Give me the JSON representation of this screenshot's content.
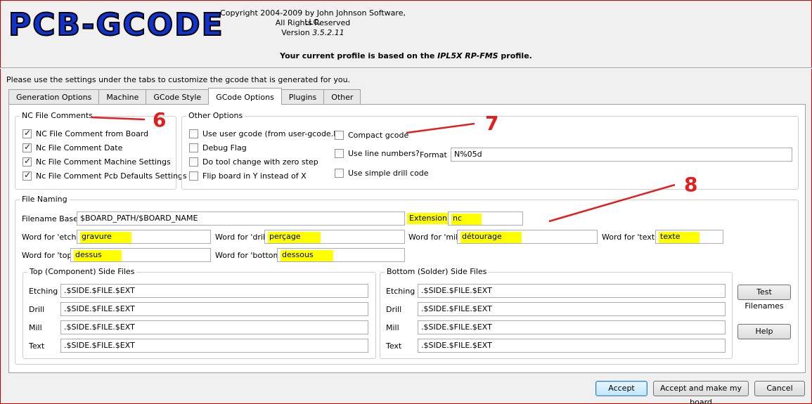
{
  "header": {
    "logo": "PCB-GCODE",
    "copyright": "Copyright 2004-2009 by John Johnson Software, LLC.",
    "rights": "All Rights Reserved",
    "version_label": "Version",
    "version": "3.5.2.11",
    "profile_pre": "Your current profile is based on the",
    "profile_name": "IPL5X RP-FMS",
    "profile_post": "profile."
  },
  "intro": "Please use the settings under the tabs to customize the gcode that is generated for you.",
  "tabs": [
    "Generation Options",
    "Machine",
    "GCode Style",
    "GCode Options",
    "Plugins",
    "Other"
  ],
  "active_tab": "GCode Options",
  "nc_comments": {
    "title": "NC File Comments",
    "items": [
      {
        "label": "NC File Comment from Board",
        "checked": true
      },
      {
        "label": "Nc File Comment Date",
        "checked": true
      },
      {
        "label": "Nc File Comment Machine Settings",
        "checked": true
      },
      {
        "label": "Nc File Comment Pcb Defaults Settings",
        "checked": true
      }
    ]
  },
  "other_options": {
    "title": "Other Options",
    "left": [
      {
        "label": "Use user gcode (from user-gcode.h)",
        "checked": false
      },
      {
        "label": "Debug Flag",
        "checked": false
      },
      {
        "label": "Do tool change with zero step",
        "checked": false
      },
      {
        "label": "Flip board in Y instead of X",
        "checked": false
      }
    ],
    "right": [
      {
        "label": "Compact gcode",
        "checked": false
      },
      {
        "label": "Use line numbers?",
        "checked": false
      },
      {
        "label": "Use simple drill code",
        "checked": false
      }
    ],
    "format_label": "Format",
    "format_value": "N%05d"
  },
  "file_naming": {
    "title": "File Naming",
    "filename_base_label": "Filename Base",
    "filename_base": "$BOARD_PATH/$BOARD_NAME",
    "extension_label": "Extension",
    "extension": "nc",
    "etch_label": "Word for 'etch'",
    "etch": "gravure",
    "drill_label": "Word for 'drill'",
    "drill": "perçage",
    "mill_label": "Word for 'mill'",
    "mill": "détourage",
    "text_label": "Word for 'text'",
    "text": "texte",
    "top_label": "Word for 'top'",
    "top": "dessus",
    "bottom_label": "Word for 'bottom'",
    "bottom": "dessous",
    "top_side": {
      "title": "Top (Component) Side Files",
      "rows": [
        {
          "label": "Etching",
          "value": ".$SIDE.$FILE.$EXT"
        },
        {
          "label": "Drill",
          "value": ".$SIDE.$FILE.$EXT"
        },
        {
          "label": "Mill",
          "value": ".$SIDE.$FILE.$EXT"
        },
        {
          "label": "Text",
          "value": ".$SIDE.$FILE.$EXT"
        }
      ]
    },
    "bottom_side": {
      "title": "Bottom (Solder) Side Files",
      "rows": [
        {
          "label": "Etching",
          "value": ".$SIDE.$FILE.$EXT"
        },
        {
          "label": "Drill",
          "value": ".$SIDE.$FILE.$EXT"
        },
        {
          "label": "Mill",
          "value": ".$SIDE.$FILE.$EXT"
        },
        {
          "label": "Text",
          "value": ".$SIDE.$FILE.$EXT"
        }
      ]
    },
    "test_button": "Test Filenames",
    "help_button": "Help"
  },
  "footer": {
    "accept": "Accept",
    "accept_make": "Accept and make my board",
    "cancel": "Cancel"
  },
  "annotations": {
    "n6": "6",
    "n7": "7",
    "n8": "8"
  },
  "colors": {
    "highlight": "#ffff00",
    "annotation": "#e02020",
    "logo": "#1133cc"
  }
}
